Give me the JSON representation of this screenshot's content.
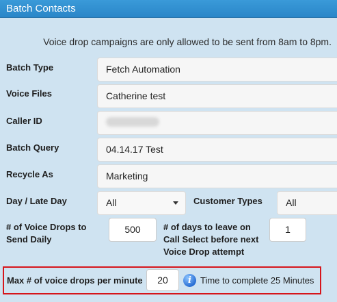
{
  "header": {
    "title": "Batch Contacts"
  },
  "notice": "Voice drop campaigns are only allowed to be sent from 8am to 8pm.",
  "fields": {
    "batch_type": {
      "label": "Batch Type",
      "value": "Fetch Automation"
    },
    "voice_files": {
      "label": "Voice Files",
      "value": "Catherine test"
    },
    "caller_id": {
      "label": "Caller ID",
      "value": ""
    },
    "batch_query": {
      "label": "Batch Query",
      "value": "04.14.17 Test"
    },
    "recycle_as": {
      "label": "Recycle As",
      "value": "Marketing"
    }
  },
  "day_late_day": {
    "label": "Day / Late Day",
    "value": "All"
  },
  "customer_types": {
    "label": "Customer Types",
    "value": "All"
  },
  "voice_drops_daily": {
    "label_line1": "# of Voice Drops to",
    "label_line2": "Send Daily",
    "value": "500"
  },
  "days_to_leave": {
    "label_line1": "# of days to leave on",
    "label_line2": "Call Select before next",
    "label_line3": "Voice Drop attempt",
    "value": "1"
  },
  "max_per_minute": {
    "label": "Max # of voice drops per minute",
    "value": "20",
    "info_glyph": "i",
    "time_text": "Time to complete 25 Minutes"
  },
  "colors": {
    "header": "#2a86c8",
    "background": "#cfe3f1",
    "highlight": "#d6151b"
  },
  "icons": [
    "info-icon",
    "chevron-down-icon"
  ]
}
